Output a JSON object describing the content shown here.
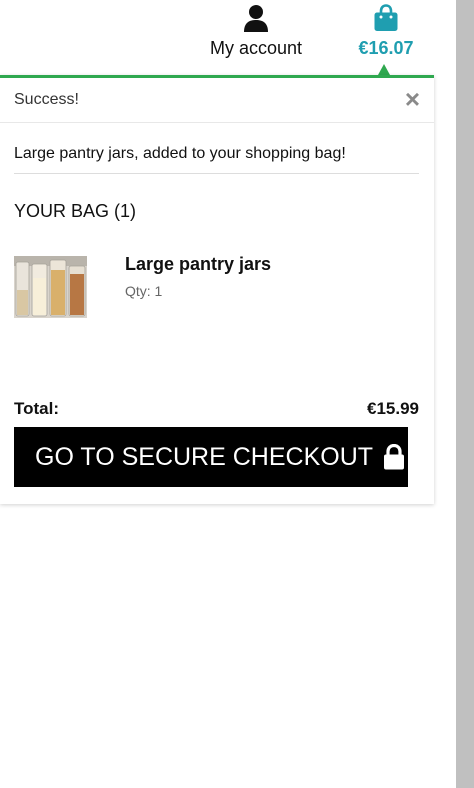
{
  "header": {
    "account": {
      "label": "My account",
      "icon": "user-icon"
    },
    "bag": {
      "total": "€16.07",
      "icon": "shopping-bag-icon",
      "color": "#1f9eb0"
    }
  },
  "toast": {
    "title": "Success!",
    "close_label": "×",
    "message": "Large pantry jars, added to your shopping bag!",
    "accent_color": "#2fa84f",
    "bag_heading": "YOUR BAG (1)",
    "items": [
      {
        "name": "Large pantry jars",
        "qty": "Qty: 1"
      }
    ],
    "total_label": "Total:",
    "total_value": "€15.99",
    "checkout_label": "GO TO SECURE CHECKOUT",
    "checkout_icon": "lock-icon"
  }
}
